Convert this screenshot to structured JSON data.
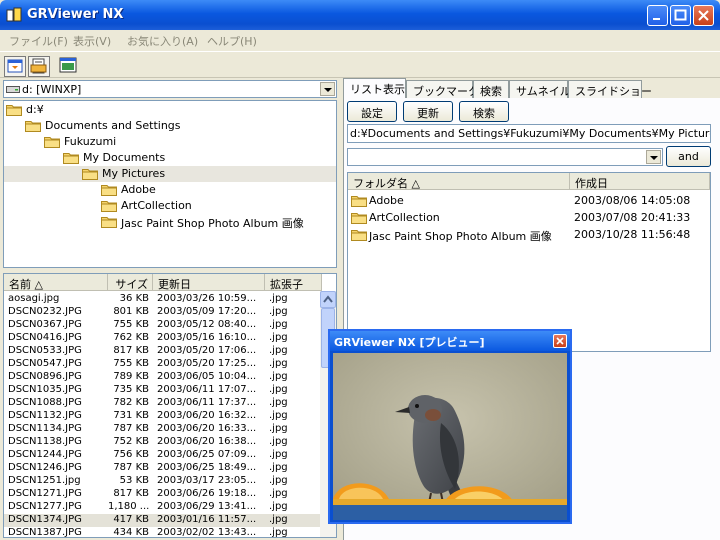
{
  "window": {
    "title": "GRViewer NX"
  },
  "menu": [
    "ファイル(F)",
    "表示(V)",
    "お気に入り(A)",
    "ヘルプ(H)"
  ],
  "toolbar": {
    "icons": [
      "tree-view-icon",
      "print-list-icon",
      "preview-window-icon"
    ]
  },
  "drive": {
    "value": "d: [WINXP]"
  },
  "tree": [
    {
      "label": "d:¥",
      "level": 0,
      "selected": false
    },
    {
      "label": "Documents and Settings",
      "level": 1,
      "selected": false
    },
    {
      "label": "Fukuzumi",
      "level": 2,
      "selected": false
    },
    {
      "label": "My Documents",
      "level": 3,
      "selected": false
    },
    {
      "label": "My Pictures",
      "level": 4,
      "selected": true
    },
    {
      "label": "Adobe",
      "level": 5,
      "selected": false
    },
    {
      "label": "ArtCollection",
      "level": 5,
      "selected": false
    },
    {
      "label": "Jasc Paint Shop Photo Album 画像",
      "level": 5,
      "selected": false
    }
  ],
  "filelist": {
    "columns": [
      "名前  △",
      "サイズ",
      "更新日",
      "拡張子"
    ],
    "rows": [
      [
        "aosagi.jpg",
        "36 KB",
        "2003/03/26 10:59...",
        ".jpg"
      ],
      [
        "DSCN0232.JPG",
        "801 KB",
        "2003/05/09 17:20...",
        ".jpg"
      ],
      [
        "DSCN0367.JPG",
        "755 KB",
        "2003/05/12 08:40...",
        ".jpg"
      ],
      [
        "DSCN0416.JPG",
        "762 KB",
        "2003/05/16 16:10...",
        ".jpg"
      ],
      [
        "DSCN0533.JPG",
        "817 KB",
        "2003/05/20 17:06...",
        ".jpg"
      ],
      [
        "DSCN0547.JPG",
        "755 KB",
        "2003/05/20 17:25...",
        ".jpg"
      ],
      [
        "DSCN0896.JPG",
        "789 KB",
        "2003/06/05 10:04...",
        ".jpg"
      ],
      [
        "DSCN1035.JPG",
        "735 KB",
        "2003/06/11 17:07...",
        ".jpg"
      ],
      [
        "DSCN1088.JPG",
        "782 KB",
        "2003/06/11 17:37...",
        ".jpg"
      ],
      [
        "DSCN1132.JPG",
        "731 KB",
        "2003/06/20 16:32...",
        ".jpg"
      ],
      [
        "DSCN1134.JPG",
        "787 KB",
        "2003/06/20 16:33...",
        ".jpg"
      ],
      [
        "DSCN1138.JPG",
        "752 KB",
        "2003/06/20 16:38...",
        ".jpg"
      ],
      [
        "DSCN1244.JPG",
        "756 KB",
        "2003/06/25 07:09...",
        ".jpg"
      ],
      [
        "DSCN1246.JPG",
        "787 KB",
        "2003/06/25 18:49...",
        ".jpg"
      ],
      [
        "DSCN1251.jpg",
        "53 KB",
        "2003/03/17 23:05...",
        ".jpg"
      ],
      [
        "DSCN1271.JPG",
        "817 KB",
        "2003/06/26 19:18...",
        ".jpg"
      ],
      [
        "DSCN1277.JPG",
        "1,180 ...",
        "2003/06/29 13:41...",
        ".jpg"
      ],
      [
        "DSCN1374.JPG",
        "417 KB",
        "2003/01/16 11:57...",
        ".jpg"
      ],
      [
        "DSCN1387.JPG",
        "434 KB",
        "2003/02/02 13:43...",
        ".jpg"
      ]
    ],
    "selected_row": 17
  },
  "tabs": [
    "リスト表示",
    "ブックマーク",
    "検索",
    "サムネイル",
    "スライドショー"
  ],
  "active_tab": 0,
  "buttons": {
    "settings": "設定",
    "refresh": "更新",
    "search": "検索",
    "and": "and"
  },
  "path": "d:¥Documents and Settings¥Fukuzumi¥My Documents¥My Pictures¥",
  "search_value": "",
  "folderlist": {
    "columns": [
      "フォルダ名  △",
      "作成日"
    ],
    "rows": [
      [
        "Adobe",
        "2003/08/06 14:05:08"
      ],
      [
        "ArtCollection",
        "2003/07/08 20:41:33"
      ],
      [
        "Jasc Paint Shop Photo Album 画像",
        "2003/10/28 11:56:48"
      ]
    ]
  },
  "preview": {
    "title": "GRViewer NX [プレビュー]"
  }
}
